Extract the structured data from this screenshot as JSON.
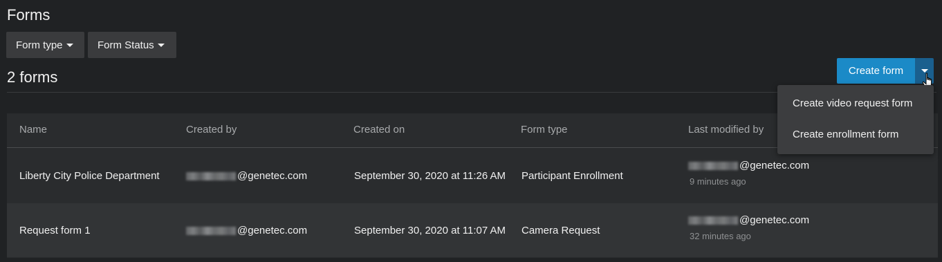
{
  "page": {
    "title": "Forms",
    "count_label": "2 forms"
  },
  "filters": {
    "form_type": "Form type",
    "form_status": "Form Status"
  },
  "actions": {
    "create_form": "Create form",
    "menu": [
      "Create video request form",
      "Create enrollment form"
    ]
  },
  "table": {
    "headers": {
      "name": "Name",
      "created_by": "Created by",
      "created_on": "Created on",
      "form_type": "Form type",
      "last_modified_by": "Last modified by"
    },
    "rows": [
      {
        "name": "Liberty City Police Department",
        "created_by": "@genetec.com",
        "created_on": "September 30, 2020 at 11:26 AM",
        "form_type": "Participant Enrollment",
        "last_modified_by": "@genetec.com",
        "last_modified_ago": "9 minutes ago"
      },
      {
        "name": "Request form 1",
        "created_by": "@genetec.com",
        "created_on": "September 30, 2020 at 11:07 AM",
        "form_type": "Camera Request",
        "last_modified_by": "@genetec.com",
        "last_modified_ago": "32 minutes ago"
      }
    ]
  },
  "colors": {
    "background": "#202224",
    "primary_button": "#1b8ac7",
    "primary_button_dark": "#1a5f8e",
    "table_bg": "#2a2c2e",
    "row_alt_bg": "#323436",
    "menu_bg": "#3c3d3f"
  }
}
